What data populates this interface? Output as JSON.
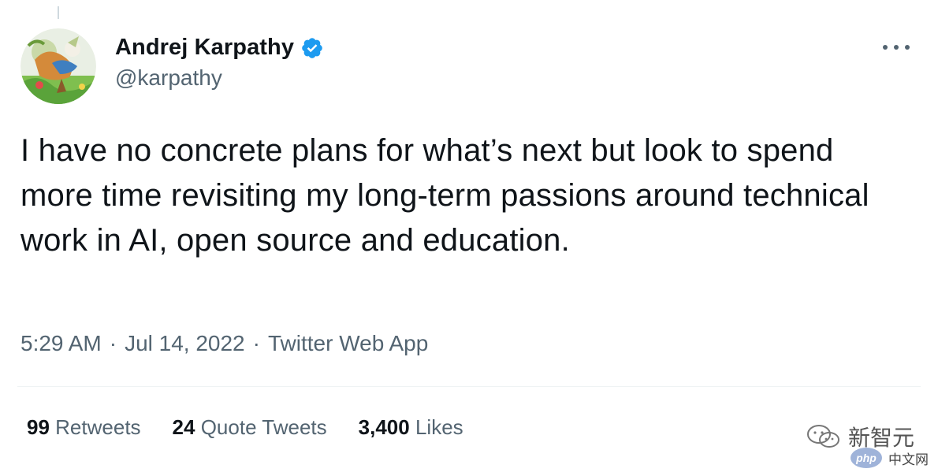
{
  "tweet": {
    "author": {
      "display_name": "Andrej Karpathy",
      "handle": "@karpathy",
      "verified": true
    },
    "text": "I have no concrete plans for what’s next but look to spend more time revisiting my long-term passions around technical work in AI, open source and education.",
    "meta": {
      "time": "5:29 AM",
      "separator": "·",
      "date": "Jul 14, 2022",
      "source": "Twitter Web App"
    },
    "stats": [
      {
        "count": "99",
        "label": "Retweets"
      },
      {
        "count": "24",
        "label": "Quote Tweets"
      },
      {
        "count": "3,400",
        "label": "Likes"
      }
    ],
    "icons": {
      "verified": "verified-badge-icon",
      "more": "more-options-icon",
      "avatar": "profile-avatar"
    }
  },
  "watermarks": {
    "wechat_text": "新智元",
    "php_logo": "php",
    "php_site": "中文网"
  },
  "colors": {
    "primary_text": "#0f1419",
    "secondary_text": "#536471",
    "verified_blue": "#1d9bf0",
    "divider": "#eff3f4"
  }
}
